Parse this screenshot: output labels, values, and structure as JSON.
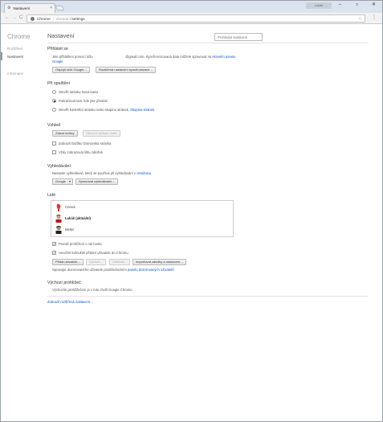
{
  "browser": {
    "tab_title": "Nastavení",
    "profile_label": "Lukáš",
    "window_controls": {
      "minimize": "–",
      "maximize": "□",
      "close": "✕"
    },
    "nav": {
      "back": "←",
      "forward": "→",
      "reload": "C"
    },
    "omnibox": {
      "origin": "Chrome",
      "separator": "|",
      "url_scheme": "chrome://",
      "url_path": "settings"
    },
    "menu_icon": "⋮"
  },
  "sidebar": {
    "brand": "Chrome",
    "items": [
      {
        "label": "Rozšíření"
      },
      {
        "label": "Nastavení"
      },
      {
        "label": "Informace"
      }
    ]
  },
  "page": {
    "title": "Nastavení",
    "search_placeholder": "Prohledat nastavení"
  },
  "signin": {
    "title": "Přihlásit se",
    "line1": "Jste přihlášeni pomocí účtu",
    "email_suffix": "@gmail.com. Synchronizovaná data můžete spravovat na",
    "link1": "Hlavním panelu",
    "link2": "Google",
    "btn_disconnect": "Odpojit účet Google…",
    "btn_sync": "Rozšířená nastavení synchronizace…"
  },
  "startup": {
    "title": "Při spuštění",
    "opt1": "Otevřít stránku Nová karta",
    "opt2": "Pokračovat tam, kde jste přestali",
    "opt3": "Otevřít konkrétní stránku nebo skupinu stránek.",
    "opt3_link": "Skupina stránek"
  },
  "appearance": {
    "title": "Vzhled",
    "btn_themes": "Získat motivy",
    "btn_reset": "Obnovit výchozí motiv",
    "check_home": "Zobrazit tlačítko Domovská stránka",
    "check_bookmarks": "Vždy zobrazovat lištu záložek"
  },
  "search": {
    "title": "Vyhledávání",
    "desc": "Nastavte vyhledávač, který se používá při vyhledávání v",
    "desc_link": "omniboxu",
    "engine": "Google",
    "btn_manage": "Spravovat vyhledávače…"
  },
  "people": {
    "title": "Lidé",
    "list": [
      {
        "name": "Cnews"
      },
      {
        "name": "Lukáš (aktuální)"
      },
      {
        "name": "Melier"
      }
    ],
    "check_guest": "Povolit prohlížení v roli hosta",
    "check_add": "Umožnit komukoli přidání uživatele do Chromu",
    "btn_add": "Přidat uživatele…",
    "btn_edit": "Upravit…",
    "btn_remove": "Odebrat…",
    "btn_import": "Importovat záložky a nastavení…",
    "supervised": "Spravujte dozorovaného uživatele prostřednictvím",
    "supervised_link": "panelu dozorovaných uživatelů"
  },
  "default_browser": {
    "title": "Výchozí prohlížeč",
    "text": "Výchozím prohlížečem je v tuto chvíli Google Chrome."
  },
  "advanced_link": "Zobrazit rozšířená nastavení…"
}
